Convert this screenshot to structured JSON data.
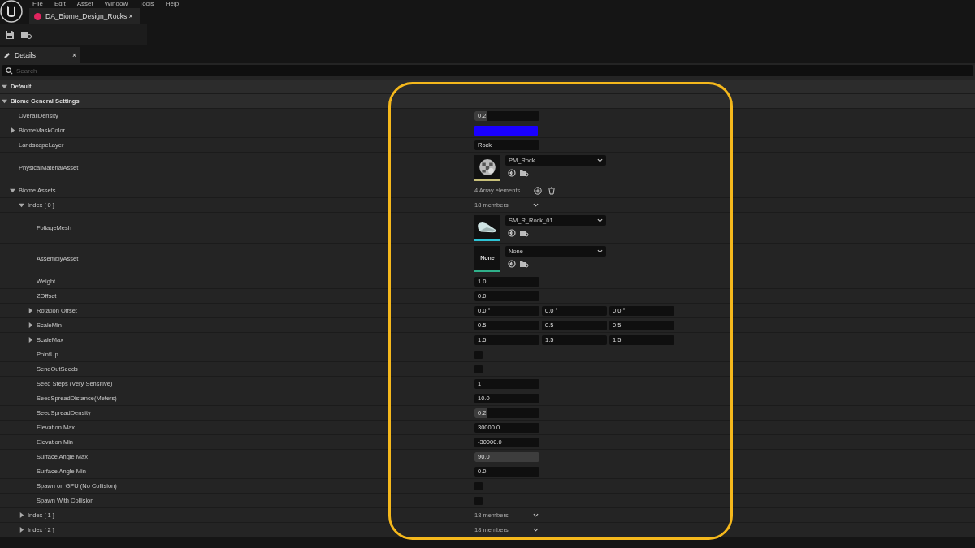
{
  "menu": [
    "File",
    "Edit",
    "Asset",
    "Window",
    "Tools",
    "Help"
  ],
  "document_tab": {
    "title": "DA_Biome_Design_Rocks",
    "close": "×",
    "color": "#e0245e"
  },
  "details_tab": {
    "title": "Details",
    "close": "×"
  },
  "search": {
    "placeholder": "Search"
  },
  "rows": [
    {
      "kind": "category",
      "label": "Default",
      "expanded": true,
      "children": [
        {
          "kind": "category",
          "label": "Biome General Settings",
          "expanded": true,
          "children": [
            {
              "kind": "number",
              "label": "OverallDensity",
              "value": "0.2",
              "level": 0.2
            },
            {
              "kind": "color",
              "label": "BiomeMaskColor",
              "expanded": false,
              "color": "#1a00ff"
            },
            {
              "kind": "text",
              "label": "LandscapeLayer",
              "value": "Rock"
            },
            {
              "kind": "asset",
              "label": "PhysicalMaterialAsset",
              "value": "PM_Rock",
              "thumbnail": {
                "kind": "material"
              },
              "color": "#c8c07a"
            }
          ]
        },
        {
          "kind": "array",
          "label": "Biome Assets",
          "expanded": true,
          "value": "4 Array elements",
          "children": [
            {
              "kind": "group",
              "label": "Index [ 0 ]",
              "value": "18 members",
              "expanded": true,
              "children": [
                {
                  "kind": "asset",
                  "label": "FoliageMesh",
                  "value": "SM_R_Rock_01",
                  "thumbnail": {
                    "kind": "mesh"
                  },
                  "color": "#2ec4d6"
                },
                {
                  "kind": "asset",
                  "label": "AssemblyAsset",
                  "value": "None",
                  "thumbnail": {
                    "kind": "empty",
                    "text": "None"
                  },
                  "color": "#2fb08a"
                },
                {
                  "kind": "number",
                  "label": "Weight",
                  "value": "1.0"
                },
                {
                  "kind": "number",
                  "label": "ZOffset",
                  "value": "0.0"
                },
                {
                  "kind": "vector",
                  "label": "Rotation Offset",
                  "expanded": false,
                  "values": [
                    "0.0 °",
                    "0.0 °",
                    "0.0 °"
                  ]
                },
                {
                  "kind": "vector",
                  "label": "ScaleMin",
                  "expanded": false,
                  "values": [
                    "0.5",
                    "0.5",
                    "0.5"
                  ]
                },
                {
                  "kind": "vector",
                  "label": "ScaleMax",
                  "expanded": false,
                  "values": [
                    "1.5",
                    "1.5",
                    "1.5"
                  ]
                },
                {
                  "kind": "checkbox",
                  "label": "PointUp",
                  "checked": false
                },
                {
                  "kind": "checkbox",
                  "label": "SendOutSeeds",
                  "checked": false
                },
                {
                  "kind": "number",
                  "label": "Seed Steps (Very Sensitive)",
                  "value": "1"
                },
                {
                  "kind": "number",
                  "label": "SeedSpreadDistance(Meters)",
                  "value": "10.0"
                },
                {
                  "kind": "number",
                  "label": "SeedSpreadDensity",
                  "value": "0.2",
                  "level": 0.2
                },
                {
                  "kind": "number",
                  "label": "Elevation Max",
                  "value": "30000.0"
                },
                {
                  "kind": "number",
                  "label": "Elevation Min",
                  "value": "-30000.0"
                },
                {
                  "kind": "number",
                  "label": "Surface Angle Max",
                  "value": "90.0",
                  "level": 1
                },
                {
                  "kind": "number",
                  "label": "Surface Angle Min",
                  "value": "0.0"
                },
                {
                  "kind": "checkbox",
                  "label": "Spawn on GPU (No Collision)",
                  "checked": false
                },
                {
                  "kind": "checkbox",
                  "label": "Spawn With Collision",
                  "checked": false
                }
              ]
            },
            {
              "kind": "group",
              "label": "Index [ 1 ]",
              "value": "18 members",
              "expanded": false
            },
            {
              "kind": "group",
              "label": "Index [ 2 ]",
              "value": "18 members",
              "expanded": false
            }
          ]
        }
      ]
    }
  ]
}
